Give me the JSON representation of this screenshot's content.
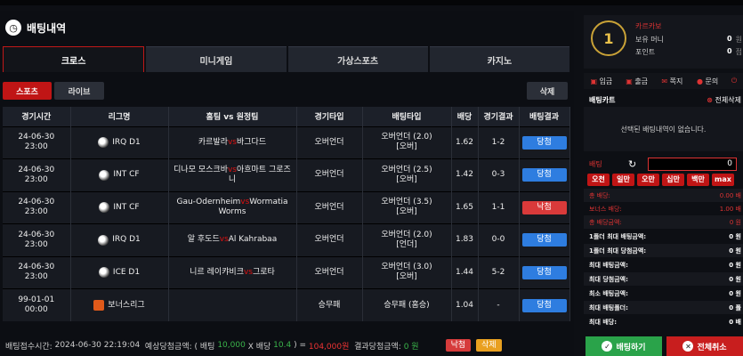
{
  "page": {
    "title": "배팅내역"
  },
  "tabs": [
    {
      "label": "크로스",
      "active": true
    },
    {
      "label": "미니게임",
      "active": false
    },
    {
      "label": "가상스포츠",
      "active": false
    },
    {
      "label": "카지노",
      "active": false
    }
  ],
  "subbar": {
    "sport": "스포츠",
    "live": "라이브",
    "delete": "삭제"
  },
  "table": {
    "headers": [
      "경기시간",
      "리그명",
      "홈팀 vs 원정팀",
      "경기타입",
      "배팅타입",
      "배당",
      "경기결과",
      "배팅결과"
    ],
    "rows": [
      {
        "time": "24-06-30 23:00",
        "league": "IRQ D1",
        "home": "카르발라",
        "away": "바그다드",
        "type": "오버언더",
        "bet_line1": "오버언더 (2.0)",
        "bet_line2": "[오버]",
        "odds": "1.62",
        "score": "1-2",
        "result": "당첨",
        "result_kind": "win"
      },
      {
        "time": "24-06-30 23:00",
        "league": "INT CF",
        "home": "디나모 모스크바",
        "away": "아흐마트 그로즈니",
        "type": "오버언더",
        "bet_line1": "오버언더 (2.5)",
        "bet_line2": "[오버]",
        "odds": "1.42",
        "score": "0-3",
        "result": "당첨",
        "result_kind": "win"
      },
      {
        "time": "24-06-30 23:00",
        "league": "INT CF",
        "home": "Gau-Odernheim",
        "away": "Wormatia Worms",
        "type": "오버언더",
        "bet_line1": "오버언더 (3.5)",
        "bet_line2": "[오버]",
        "odds": "1.65",
        "score": "1-1",
        "result": "낙첨",
        "result_kind": "lose"
      },
      {
        "time": "24-06-30 23:00",
        "league": "IRQ D1",
        "home": "알 후도드",
        "away": "Al Kahrabaa",
        "type": "오버언더",
        "bet_line1": "오버언더 (2.0)",
        "bet_line2": "[언더]",
        "odds": "1.83",
        "score": "0-0",
        "result": "당첨",
        "result_kind": "win"
      },
      {
        "time": "24-06-30 23:00",
        "league": "ICE D1",
        "home": "니르 레이캬비크",
        "away": "그로타",
        "type": "오버언더",
        "bet_line1": "오버언더 (3.0)",
        "bet_line2": "[오버]",
        "odds": "1.44",
        "score": "5-2",
        "result": "당첨",
        "result_kind": "win"
      },
      {
        "time": "99-01-01 00:00",
        "league": "보너스리그",
        "home": "",
        "away": "",
        "type": "승무패",
        "bet_line1": "승무패 (홈승)",
        "bet_line2": "",
        "odds": "1.04",
        "score": "-",
        "result": "당첨",
        "result_kind": "win"
      }
    ]
  },
  "footer": {
    "label_time": "배팅접수시간:",
    "time": "2024-06-30 22:19:04",
    "label_expected": "예상당첨금액: ( 배팅",
    "stake": "10,000",
    "label_x": "X 배당",
    "odds": "10.4",
    "label_eq": ") =",
    "payout": "104,000원",
    "label_result": "결과당첨금액:",
    "result": "0 원",
    "btn_status": "낙첨",
    "btn_delete": "삭제"
  },
  "side": {
    "user": {
      "rank": "1",
      "name": "카르카보",
      "money_label": "보유 머니",
      "money": "0",
      "money_unit": "원",
      "point_label": "포인트",
      "point": "0",
      "point_unit": "점"
    },
    "quick": [
      "입금",
      "출금",
      "쪽지",
      "문의"
    ],
    "cart": {
      "title": "배팅카트",
      "all": "전체삭제",
      "empty": "선택된 배팅내역이 없습니다."
    },
    "bet_label": "배팅",
    "bet_value": "0",
    "amounts": [
      "오천",
      "일만",
      "오만",
      "십만",
      "백만",
      "max"
    ],
    "info_red": [
      {
        "label": "총 배당:",
        "value": "0.00 배"
      },
      {
        "label": "보너스 배당:",
        "value": "1.00 배"
      },
      {
        "label": "총 배당금액:",
        "value": "0 원"
      }
    ],
    "info_white": [
      {
        "label": "1폴더 최대 배팅금액:",
        "value": "0 원"
      },
      {
        "label": "1폴더 최대 당첨금액:",
        "value": "0 원"
      },
      {
        "label": "최대 배팅금액:",
        "value": "0 원"
      },
      {
        "label": "최대 당첨금액:",
        "value": "0 원"
      },
      {
        "label": "최소 배팅금액:",
        "value": "0 원"
      },
      {
        "label": "최대 배팅폴더:",
        "value": "0 폴"
      },
      {
        "label": "최대 배당:",
        "value": "0 배"
      }
    ],
    "actions": {
      "bet": "배팅하기",
      "cancel": "전체취소"
    }
  }
}
